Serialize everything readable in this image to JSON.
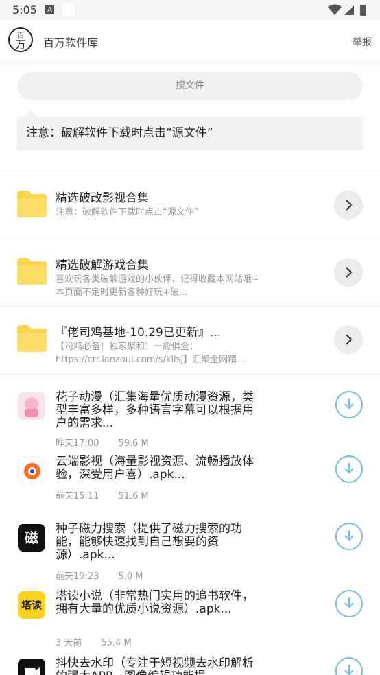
{
  "status_bar": {
    "time": "5:05",
    "indicator": "A"
  },
  "header": {
    "logo_top": "百",
    "logo_bottom": "万",
    "title": "百万软件库",
    "report": "举报"
  },
  "search": {
    "placeholder": "搜文件"
  },
  "notice": {
    "text": "注意：破解软件下载时点击“源文件”"
  },
  "folders": [
    {
      "title": "精选破改影视合集",
      "desc": "注意：破解软件下载时点击“源文件”"
    },
    {
      "title": "精选破解游戏合集",
      "desc": "喜欢玩各类破解游戏的小伙伴，记得收藏本网站哦~本页面不定时更新各种好玩+破..."
    },
    {
      "title": "『佬司鸡基地-10.29已更新』...",
      "desc": "【司鸡必备！独家聚和！一应俱全：https://crr.lanzoui.com/s/kllsj】汇聚全网精..."
    }
  ],
  "files": [
    {
      "title": "花子动漫（汇集海量优质动漫资源，类型丰富多样，多种语言字幕可以根据用户的需求...",
      "date": "昨天17:00",
      "size": "59.6 M"
    },
    {
      "title": "云端影视（海量影视资源、流畅播放体验，深受用户喜）.apk...",
      "date": "前天15:11",
      "size": "51.6 M"
    },
    {
      "title": "种子磁力搜索（提供了磁力搜索的功能，能够快速找到自己想要的资源）.apk...",
      "date": "前天19:23",
      "size": "5.0 M"
    },
    {
      "title": "塔读小说（非常热门实用的追书软件，拥有大量的优质小说资源）.apk...",
      "date": "3 天前",
      "size": "55.4 M"
    },
    {
      "title": "抖快去水印（专注于短视频去水印解析的强大APP，图像编辑功能提...",
      "date": "",
      "size": ""
    }
  ],
  "icons": {
    "file_icon_3_text": "磁",
    "file_icon_4_text": "塔读"
  },
  "colors": {
    "folder": "#ffd54f",
    "download": "#6ec1e4",
    "accent_text": "#999999"
  }
}
